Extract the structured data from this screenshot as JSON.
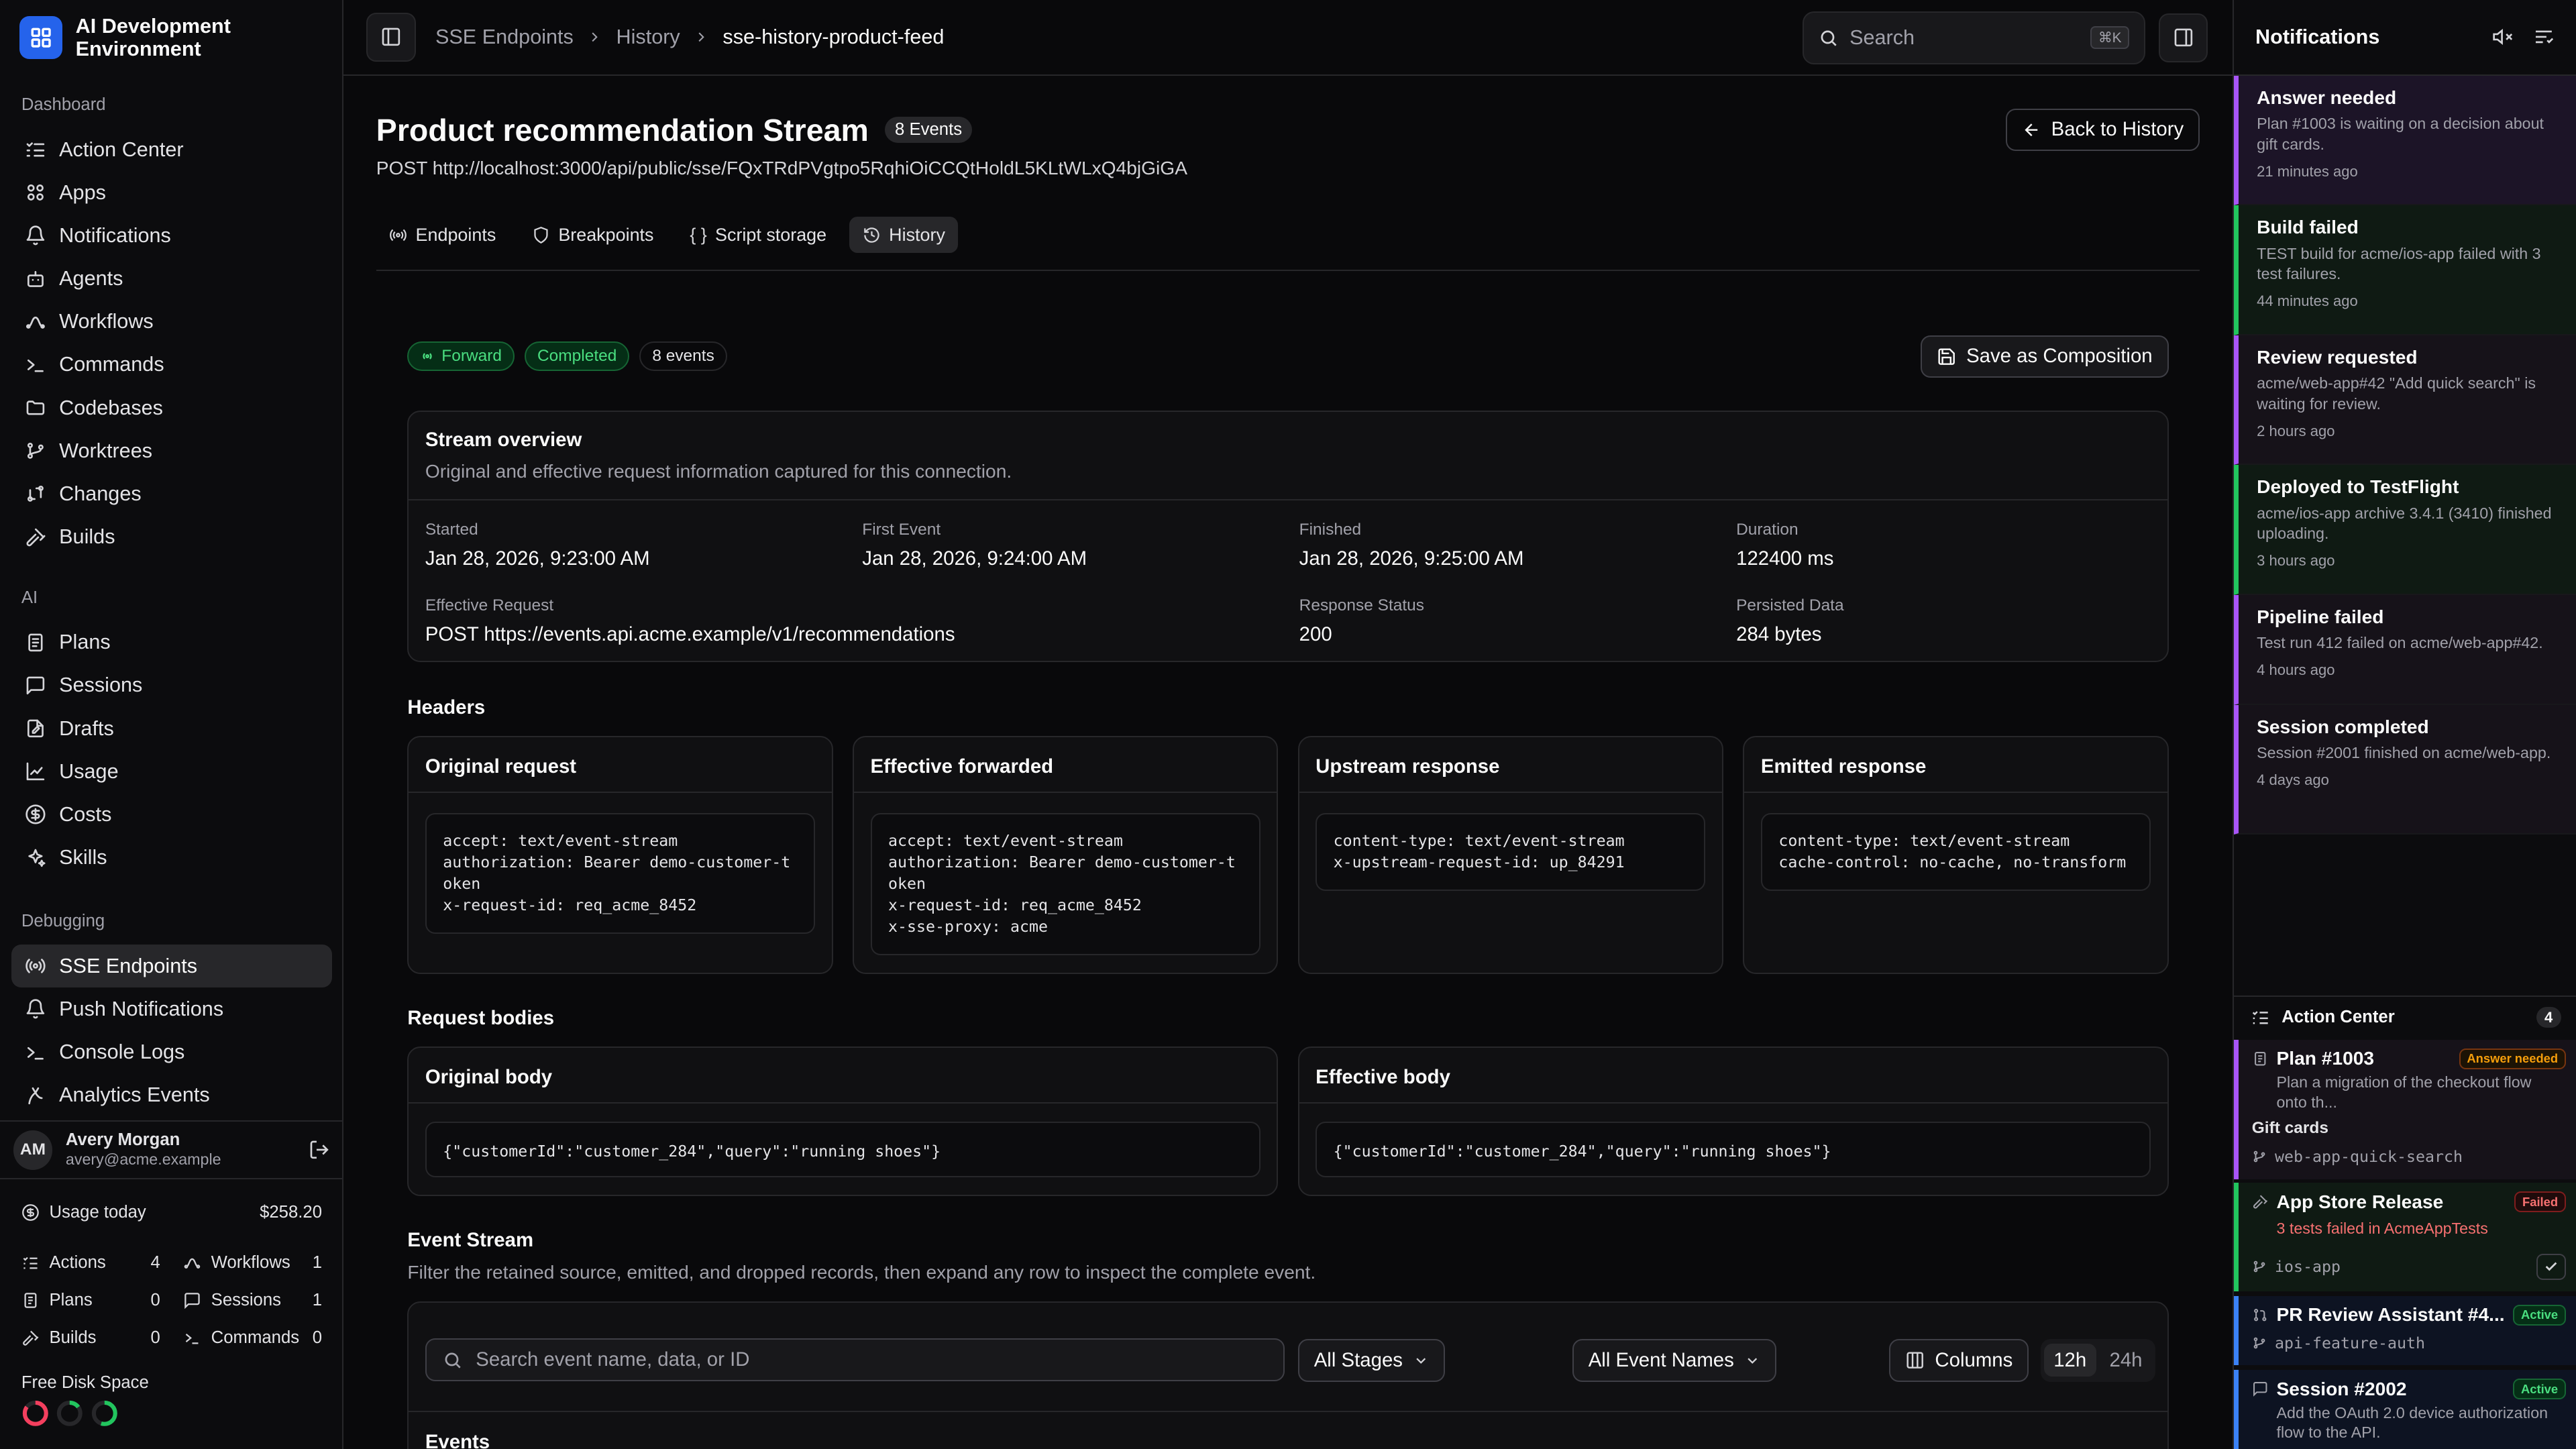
{
  "app": {
    "name": "AI Development Environment"
  },
  "sidebar": {
    "sections": [
      {
        "title": "Dashboard",
        "items": [
          {
            "label": "Action Center",
            "icon": "list-check-icon"
          },
          {
            "label": "Apps",
            "icon": "apps-icon"
          },
          {
            "label": "Notifications",
            "icon": "bell-icon"
          },
          {
            "label": "Agents",
            "icon": "bot-icon"
          },
          {
            "label": "Workflows",
            "icon": "workflow-icon"
          },
          {
            "label": "Commands",
            "icon": "terminal-icon"
          },
          {
            "label": "Codebases",
            "icon": "folder-icon"
          },
          {
            "label": "Worktrees",
            "icon": "git-branch-icon"
          },
          {
            "label": "Changes",
            "icon": "git-compare-icon"
          },
          {
            "label": "Builds",
            "icon": "hammer-icon"
          }
        ]
      },
      {
        "title": "AI",
        "items": [
          {
            "label": "Plans",
            "icon": "clipboard-icon"
          },
          {
            "label": "Sessions",
            "icon": "chat-icon"
          },
          {
            "label": "Drafts",
            "icon": "file-edit-icon"
          },
          {
            "label": "Usage",
            "icon": "chart-icon"
          },
          {
            "label": "Costs",
            "icon": "dollar-icon"
          },
          {
            "label": "Skills",
            "icon": "sparkles-icon"
          }
        ]
      },
      {
        "title": "Debugging",
        "items": [
          {
            "label": "SSE Endpoints",
            "icon": "radio-icon",
            "active": true
          },
          {
            "label": "Push Notifications",
            "icon": "bell-icon"
          },
          {
            "label": "Console Logs",
            "icon": "terminal-icon"
          },
          {
            "label": "Analytics Events",
            "icon": "activity-icon"
          }
        ]
      }
    ],
    "user": {
      "initials": "AM",
      "name": "Avery Morgan",
      "email": "avery@acme.example"
    },
    "usage": {
      "label": "Usage today",
      "amount": "$258.20",
      "stats": [
        {
          "label": "Actions",
          "value": "4"
        },
        {
          "label": "Workflows",
          "value": "1"
        },
        {
          "label": "Plans",
          "value": "0"
        },
        {
          "label": "Sessions",
          "value": "1"
        },
        {
          "label": "Builds",
          "value": "0"
        },
        {
          "label": "Commands",
          "value": "0"
        }
      ]
    },
    "disk": {
      "label": "Free Disk Space",
      "rings": [
        {
          "color": "#f43f5e",
          "fraction": 0.15
        },
        {
          "color": "#22c55e",
          "fraction": 0.85
        },
        {
          "color": "#22c55e",
          "fraction": 0.45
        }
      ]
    }
  },
  "topbar": {
    "breadcrumbs": [
      "SSE Endpoints",
      "History",
      "sse-history-product-feed"
    ],
    "search_placeholder": "Search",
    "search_shortcut": "⌘K"
  },
  "page": {
    "title": "Product recommendation Stream",
    "event_badge": "8 Events",
    "url": "POST http://localhost:3000/api/public/sse/FQxTRdPVgtpo5RqhiOiCCQtHoldL5KLtWLxQ4bjGiGA",
    "back_label": "Back to History",
    "tabs": [
      {
        "label": "Endpoints"
      },
      {
        "label": "Breakpoints"
      },
      {
        "label": "Script storage"
      },
      {
        "label": "History",
        "active": true
      }
    ],
    "chips": {
      "forward": "Forward",
      "status": "Completed",
      "events": "8 events"
    },
    "save_label": "Save as Composition",
    "overview": {
      "title": "Stream overview",
      "subtitle": "Original and effective request information captured for this connection.",
      "fields": [
        {
          "label": "Started",
          "value": "Jan 28, 2026, 9:23:00 AM"
        },
        {
          "label": "First Event",
          "value": "Jan 28, 2026, 9:24:00 AM"
        },
        {
          "label": "Finished",
          "value": "Jan 28, 2026, 9:25:00 AM"
        },
        {
          "label": "Duration",
          "value": "122400 ms"
        },
        {
          "label": "Effective Request",
          "value": "POST https://events.api.acme.example/v1/recommendations"
        },
        {
          "label": "Response Status",
          "value": "200"
        },
        {
          "label": "Persisted Data",
          "value": "284 bytes"
        }
      ]
    },
    "headers": {
      "title": "Headers",
      "cards": [
        {
          "title": "Original request",
          "code": "accept: text/event-stream\nauthorization: Bearer demo-customer-token\nx-request-id: req_acme_8452"
        },
        {
          "title": "Effective forwarded",
          "code": "accept: text/event-stream\nauthorization: Bearer demo-customer-token\nx-request-id: req_acme_8452\nx-sse-proxy: acme"
        },
        {
          "title": "Upstream response",
          "code": "content-type: text/event-stream\nx-upstream-request-id: up_84291"
        },
        {
          "title": "Emitted response",
          "code": "content-type: text/event-stream\ncache-control: no-cache, no-transform"
        }
      ]
    },
    "bodies": {
      "title": "Request bodies",
      "cards": [
        {
          "title": "Original body",
          "code": "{\"customerId\":\"customer_284\",\"query\":\"running shoes\"}"
        },
        {
          "title": "Effective body",
          "code": "{\"customerId\":\"customer_284\",\"query\":\"running shoes\"}"
        }
      ]
    },
    "event_stream": {
      "title": "Event Stream",
      "subtitle": "Filter the retained source, emitted, and dropped records, then expand any row to inspect the complete event.",
      "search_placeholder": "Search event name, data, or ID",
      "stage_select": "All Stages",
      "name_select": "All Event Names",
      "columns_label": "Columns",
      "range_12h": "12h",
      "range_24h": "24h",
      "events_heading": "Events"
    }
  },
  "notifications": {
    "title": "Notifications",
    "items": [
      {
        "title": "Answer needed",
        "desc": "Plan #1003 is waiting on a decision about gift cards.",
        "age": "21 minutes ago",
        "color": "#a855f7",
        "bg": "#1c1427"
      },
      {
        "title": "Build failed",
        "desc": "TEST build for acme/ios-app failed with 3 test failures.",
        "age": "44 minutes ago",
        "color": "#22c55e",
        "bg": "#0f1a13"
      },
      {
        "title": "Review requested",
        "desc": "acme/web-app#42 \"Add quick search\" is waiting for review.",
        "age": "2 hours ago",
        "color": "#a855f7",
        "bg": "#161219"
      },
      {
        "title": "Deployed to TestFlight",
        "desc": "acme/ios-app archive 3.4.1 (3410) finished uploading.",
        "age": "3 hours ago",
        "color": "#22c55e",
        "bg": "#0f1a13"
      },
      {
        "title": "Pipeline failed",
        "desc": "Test run 412 failed on acme/web-app#42.",
        "age": "4 hours ago",
        "color": "#a855f7",
        "bg": "#161219"
      },
      {
        "title": "Session completed",
        "desc": "Session #2001 finished on acme/web-app.",
        "age": "4 days ago",
        "color": "#a855f7",
        "bg": "#161219"
      }
    ]
  },
  "action_center": {
    "title": "Action Center",
    "count": "4",
    "items": [
      {
        "title": "Plan #1003",
        "badge": "Answer needed",
        "desc": "Plan a migration of the checkout flow onto th...",
        "extra": "Gift cards",
        "branch": "web-app-quick-search",
        "color": "#a855f7"
      },
      {
        "title": "App Store Release",
        "badge": "Failed",
        "desc": "3 tests failed in AcmeAppTests",
        "branch": "ios-app",
        "color": "#22c55e"
      },
      {
        "title": "PR Review Assistant #4...",
        "badge": "Active",
        "branch": "api-feature-auth",
        "color": "#3b82f6"
      },
      {
        "title": "Session #2002",
        "badge": "Active",
        "desc": "Add the OAuth 2.0 device authorization flow to the API.",
        "color": "#3b82f6"
      }
    ]
  }
}
